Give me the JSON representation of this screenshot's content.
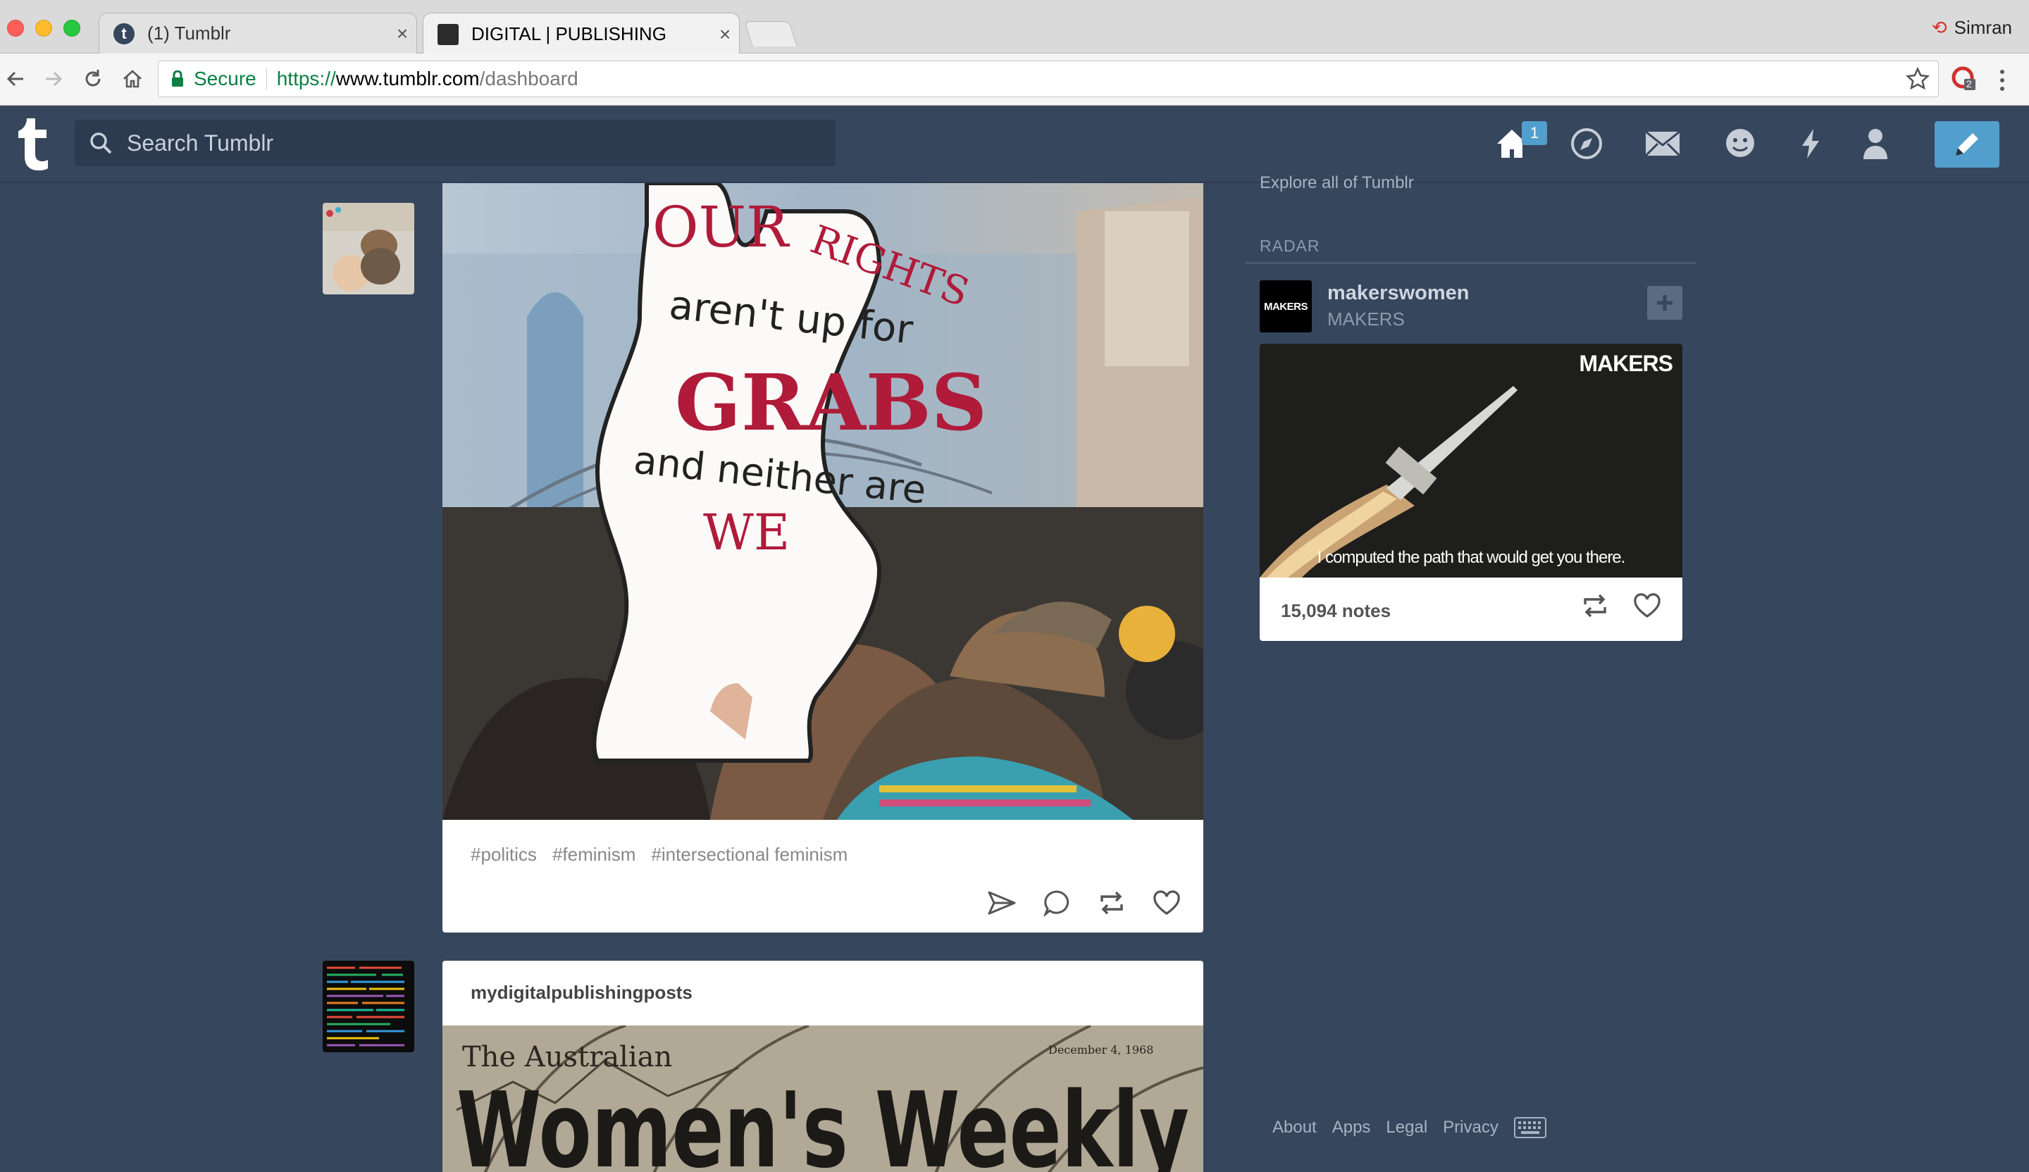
{
  "browser": {
    "tabs": [
      {
        "title": "(1) Tumblr",
        "favicon": "t"
      },
      {
        "title": "DIGITAL | PUBLISHING",
        "favicon": ""
      }
    ],
    "close_glyph": "×",
    "profile_name": "Simran",
    "secure_label": "Secure",
    "url": {
      "scheme": "https://",
      "host": "www.tumblr.com",
      "path": "/dashboard"
    },
    "extension_badge": "2"
  },
  "tumblr_header": {
    "logo": "t",
    "search_placeholder": "Search Tumblr",
    "home_badge": "1",
    "icons": [
      "home-icon",
      "explore-icon",
      "inbox-icon",
      "messaging-icon",
      "activity-icon",
      "account-icon",
      "compose-icon"
    ],
    "accent": "#529ecc",
    "background": "#36465d"
  },
  "posts": [
    {
      "author": "",
      "photo_text": {
        "line1": "OUR",
        "line2": "RIGHTS",
        "line3": "aren't up for",
        "line4": "GRABS",
        "line5": "and neither are",
        "line6": "WE"
      },
      "tags": [
        "#politics",
        "#feminism",
        "#intersectional feminism"
      ]
    },
    {
      "author": "mydigitalpublishingposts",
      "photo_text": {
        "masthead_small": "The Australian",
        "masthead_big": "Women's Weekly",
        "date": "December 4, 1968"
      }
    }
  ],
  "sidebar": {
    "explore_link": "Explore all of Tumblr",
    "radar_heading": "RADAR",
    "radar": {
      "avatar_text": "MAKERS",
      "blog_name": "makerswomen",
      "blog_title": "MAKERS",
      "media_brand": "MAKERS",
      "media_caption": "I computed the path that would get you there.",
      "notes": "15,094 notes"
    },
    "footer_links": [
      "About",
      "Apps",
      "Legal",
      "Privacy"
    ]
  }
}
